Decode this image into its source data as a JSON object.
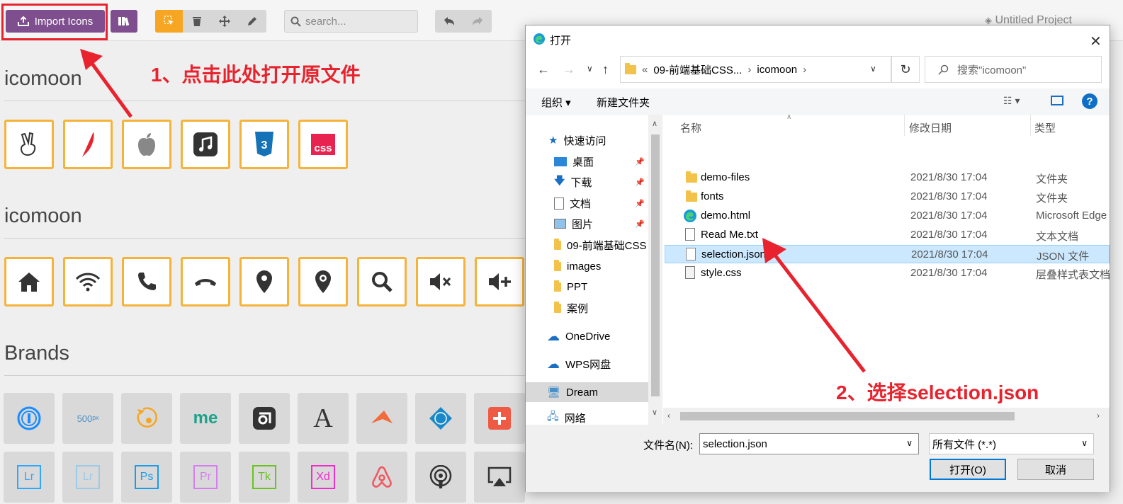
{
  "toolbar": {
    "import_label": "Import Icons",
    "search_placeholder": "search...",
    "project_name": "Untitled Project"
  },
  "sets": [
    {
      "title": "icomoon",
      "icons": [
        "peace-hand-icon",
        "feather-quill-icon",
        "apple-icon",
        "music-app-icon",
        "css3-icon",
        "css-box-icon"
      ]
    },
    {
      "title": "icomoon",
      "icons": [
        "home-icon",
        "wifi-icon",
        "phone-icon",
        "hangup-icon",
        "map-pin-icon",
        "map-pin-outline-icon",
        "search-icon",
        "volume-mute-icon",
        "volume-plus-icon"
      ]
    },
    {
      "title": "Brands",
      "row1": [
        "1password-icon",
        "500px-icon",
        "accusoft-icon",
        "me-icon",
        "outlook-box-icon",
        "a-font-icon",
        "arrow-plane-icon",
        "acm-icon",
        "plus-box-icon"
      ],
      "row2": [
        "lightroom-icon",
        "lightroom-light-icon",
        "photoshop-icon",
        "premiere-icon",
        "tk-icon",
        "xd-icon",
        "airbnb-icon",
        "podcast-icon",
        "airplay-icon"
      ]
    }
  ],
  "brand_glyphs": {
    "500px": "500ᵖˣ",
    "me": "me",
    "a": "A",
    "lr": "Lr",
    "ps": "Ps",
    "pr": "Pr",
    "tk": "Tk",
    "xd": "Xd",
    "css": "css"
  },
  "annotations": {
    "step1": "1、点击此处打开原文件",
    "step2": "2、选择selection.json"
  },
  "dialog": {
    "title": "打开",
    "address": [
      "«",
      "09-前端基础CSS...",
      "›",
      "icomoon",
      "›"
    ],
    "search_placeholder": "搜索\"icomoon\"",
    "organize": "组织 ▾",
    "new_folder": "新建文件夹",
    "columns": {
      "name": "名称",
      "date": "修改日期",
      "type": "类型"
    },
    "nav": [
      {
        "label": "快速访问",
        "icon": "star-icon"
      },
      {
        "label": "桌面",
        "icon": "desktop-icon",
        "pinned": true
      },
      {
        "label": "下载",
        "icon": "download-icon",
        "pinned": true
      },
      {
        "label": "文档",
        "icon": "document-icon",
        "pinned": true
      },
      {
        "label": "图片",
        "icon": "picture-icon",
        "pinned": true
      },
      {
        "label": "09-前端基础CSS",
        "icon": "folder-icon"
      },
      {
        "label": "images",
        "icon": "folder-icon"
      },
      {
        "label": "PPT",
        "icon": "folder-icon"
      },
      {
        "label": "案例",
        "icon": "folder-icon"
      },
      {
        "label": "OneDrive",
        "icon": "cloud-icon"
      },
      {
        "label": "WPS网盘",
        "icon": "cloud-outline-icon"
      },
      {
        "label": "Dream",
        "icon": "computer-icon"
      },
      {
        "label": "网络",
        "icon": "network-icon"
      }
    ],
    "files": [
      {
        "name": "demo-files",
        "date": "2021/8/30 17:04",
        "type": "文件夹",
        "icon": "folder-icon"
      },
      {
        "name": "fonts",
        "date": "2021/8/30 17:04",
        "type": "文件夹",
        "icon": "folder-icon"
      },
      {
        "name": "demo.html",
        "date": "2021/8/30 17:04",
        "type": "Microsoft Edge",
        "icon": "edge-icon"
      },
      {
        "name": "Read Me.txt",
        "date": "2021/8/30 17:04",
        "type": "文本文档",
        "icon": "text-file-icon"
      },
      {
        "name": "selection.json",
        "date": "2021/8/30 17:04",
        "type": "JSON 文件",
        "icon": "file-icon"
      },
      {
        "name": "style.css",
        "date": "2021/8/30 17:04",
        "type": "层叠样式表文档",
        "icon": "css-file-icon"
      }
    ],
    "filename_label": "文件名(N):",
    "filename_value": "selection.json",
    "filetype_value": "所有文件 (*.*)",
    "open_label": "打开(O)",
    "cancel_label": "取消"
  },
  "colors": {
    "accent": "#7e4e8e",
    "orange": "#f6a623",
    "red": "#e8232e",
    "select": "#cce8ff"
  }
}
